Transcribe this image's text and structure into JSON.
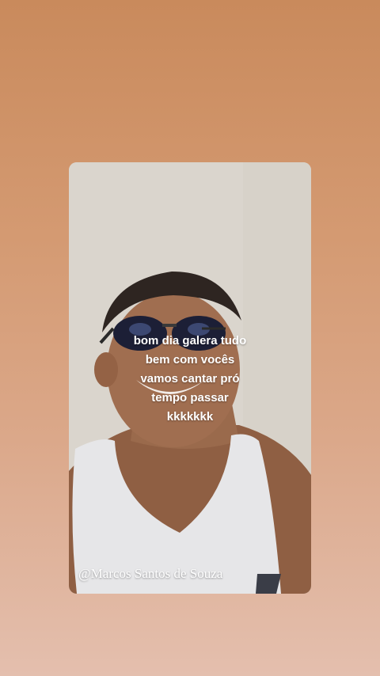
{
  "story": {
    "caption_lines": [
      "bom dia galera tudo",
      "bem com vocês",
      "vamos cantar pró",
      "tempo passar",
      "kkkkkkk"
    ],
    "watermark": "@Marcos Santos de Souza"
  },
  "colors": {
    "background_top": "#c98a5c",
    "background_bottom": "#e4bfae",
    "card_wall": "#dcd7cf",
    "tank_top": "#e6e6e8",
    "skin": "#9a6a4c"
  },
  "icons": {
    "photo": "person-selfie-photo"
  }
}
